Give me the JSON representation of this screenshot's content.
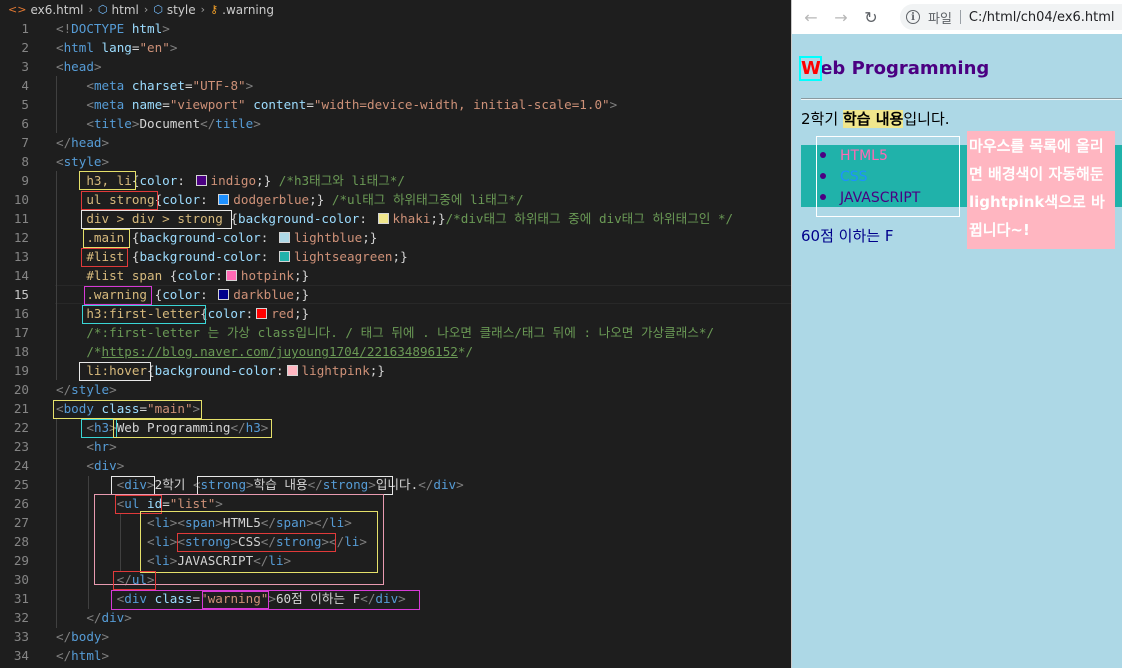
{
  "editor": {
    "breadcrumb": [
      {
        "icon": "html-file-icon",
        "glyph": "<>",
        "label": "ex6.html"
      },
      {
        "icon": "cube-icon",
        "glyph": "⬡",
        "label": "html"
      },
      {
        "icon": "cube-icon",
        "glyph": "⬡",
        "label": "style"
      },
      {
        "icon": "symbol-key-icon",
        "glyph": "⚷",
        "label": ".warning"
      }
    ],
    "breadcrumb_separator": "›",
    "line_numbers": [
      "1",
      "2",
      "3",
      "4",
      "5",
      "6",
      "7",
      "8",
      "9",
      "10",
      "11",
      "12",
      "13",
      "14",
      "15",
      "16",
      "17",
      "18",
      "19",
      "20",
      "21",
      "22",
      "23",
      "24",
      "25",
      "26",
      "27",
      "28",
      "29",
      "30",
      "31",
      "32",
      "33",
      "34"
    ],
    "active_line": "15",
    "swatch_colors": {
      "indigo": "#4b0082",
      "dodgerblue": "#1e90ff",
      "khaki": "#f0e68c",
      "lightblue": "#add8e6",
      "lightseagreen": "#20b2aa",
      "hotpink": "#ff69b4",
      "darkblue": "#00008b",
      "red": "#ff0000",
      "lightpink": "#ffb6c1"
    },
    "annotation_colors": {
      "yellow": "#e5e06a",
      "red": "#e03a3a",
      "white": "#e8e8e8",
      "magenta": "#d63ad6",
      "cyan": "#3ad6d6",
      "pink": "#e89ab0"
    }
  },
  "browser": {
    "nav": {
      "back": "←",
      "forward": "→",
      "reload": "↻"
    },
    "info_glyph": "i",
    "scheme_label": "파일",
    "url": "C:/html/ch04/ex6.html",
    "page": {
      "h3_first": "W",
      "h3_rest": "eb Programming",
      "text_before": "2학기 ",
      "text_strong": "학습 내용",
      "text_after": "입니다.",
      "list": [
        "HTML5",
        "CSS",
        "JAVASCRIPT"
      ],
      "tooltip": "마우스를 목록에 올리면 배경색이 자동해둔 lightpink색으로 바뀝니다~!",
      "warning": "60점 이하는 F"
    },
    "colors": {
      "page_bg": "#add8e6",
      "h3": "#4b0082",
      "first_letter": "#ff0000",
      "strong_bg": "#f0e68c",
      "list_bg": "#20b2aa",
      "span": "#ff69b4",
      "strong_css": "#1e90ff",
      "li_hover": "#ffb6c1",
      "warning": "#00008b"
    }
  }
}
